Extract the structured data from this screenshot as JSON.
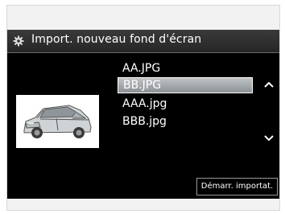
{
  "header": {
    "title": "Import. nouveau fond d'écran",
    "icon": "gear-icon"
  },
  "preview": {
    "icon": "car-thumbnail"
  },
  "files": {
    "items": [
      "AA.JPG",
      "BB.JPG",
      "AAA.jpg",
      "BBB.jpg"
    ],
    "selected": "BB.JPG"
  },
  "scroll": {
    "up_icon": "chevron-up-icon",
    "down_icon": "chevron-down-icon"
  },
  "actions": {
    "import_label": "Démarr. importat."
  },
  "colors": {
    "screen_bg": "#000000",
    "selection": "#a9aeb2",
    "text": "#ffffff"
  }
}
